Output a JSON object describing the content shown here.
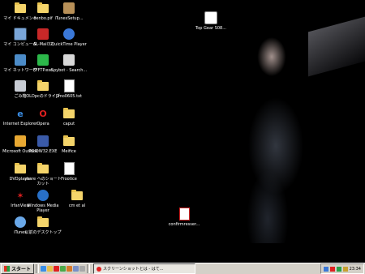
{
  "desktop_icons": [
    {
      "label": "マイ ドキュメント",
      "icon": "my-documents-icon"
    },
    {
      "label": "denbo.pif",
      "icon": "folder-icon"
    },
    {
      "label": "iTunesSetup...",
      "icon": "installer-icon"
    },
    {
      "label": "マイ コンピュータ",
      "icon": "my-computer-icon"
    },
    {
      "label": "AL-Mail32",
      "icon": "mail-icon"
    },
    {
      "label": "QuickTime Player",
      "icon": "quicktime-icon"
    },
    {
      "label": "マイ ネットワーク",
      "icon": "network-icon"
    },
    {
      "label": "FFFTP.exe",
      "icon": "ffftp-icon"
    },
    {
      "label": "Spybot - Search...",
      "icon": "spybot-icon"
    },
    {
      "label": "ごみ箱",
      "icon": "recycle-bin-icon"
    },
    {
      "label": "OLDpcのドライブ",
      "icon": "folder-icon"
    },
    {
      "label": "jimo0605.txt",
      "icon": "text-file-icon"
    },
    {
      "label": "Internet Explorer",
      "icon": "ie-icon"
    },
    {
      "label": "Opera",
      "icon": "opera-icon"
    },
    {
      "label": "caput",
      "icon": "folder-icon"
    },
    {
      "label": "Microsoft Outlook",
      "icon": "outlook-icon"
    },
    {
      "label": "PDIDW32.EXE",
      "icon": "app-icon"
    },
    {
      "label": "Meifice",
      "icon": "folder-icon"
    },
    {
      "label": "DVDplayer",
      "icon": "folder-icon"
    },
    {
      "label": "share へのショートカット",
      "icon": "folder-icon"
    },
    {
      "label": "Frootice",
      "icon": "document-icon"
    },
    {
      "label": "IrfanView",
      "icon": "irfanview-icon"
    },
    {
      "label": "Windows Media Player",
      "icon": "media-player-icon"
    },
    {
      "label": "cm et al",
      "icon": "folder-icon"
    },
    {
      "label": "iTunes",
      "icon": "itunes-icon"
    },
    {
      "label": "以前のデスクトップ",
      "icon": "folder-icon"
    },
    {
      "label": "Top Gear S08...",
      "icon": "video-file-icon"
    },
    {
      "label": "confirmresser...",
      "icon": "pdf-file-icon"
    }
  ],
  "taskbar": {
    "start_label": "スタート",
    "task_label": "スクリーンショットとは - はて...",
    "clock": "23:34"
  },
  "colors": {
    "taskbar": "#d4d0c8",
    "desktop": "#000000"
  }
}
